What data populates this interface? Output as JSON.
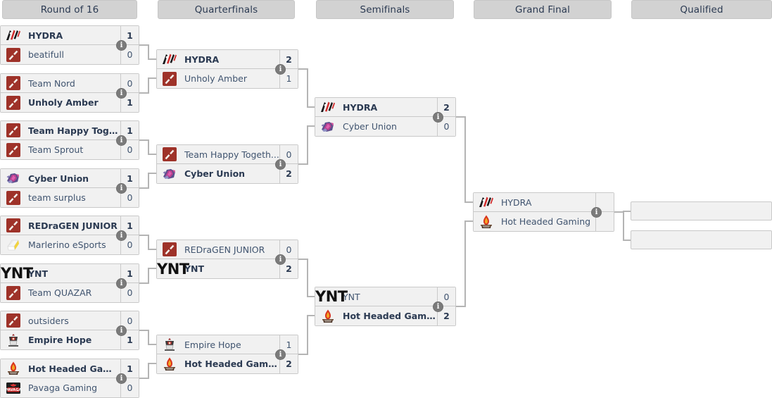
{
  "rounds": [
    {
      "id": "r16",
      "label": "Round of 16"
    },
    {
      "id": "qf",
      "label": "Quarterfinals"
    },
    {
      "id": "sf",
      "label": "Semifinals"
    },
    {
      "id": "gf",
      "label": "Grand Final"
    },
    {
      "id": "q",
      "label": "Qualified"
    }
  ],
  "info_glyph": "i",
  "colors": {
    "header_bg": "#d2d2d2",
    "box_bg": "#f1f1f1",
    "box_border": "#c9c9c9",
    "connector": "#b4b4b4",
    "text": "#40546f",
    "text_bold": "#2b3a52",
    "dota_red": "#a03127"
  },
  "round_of_16": [
    {
      "top": {
        "name": "HYDRA",
        "score": "1",
        "winner": true,
        "logo": "hydra"
      },
      "bottom": {
        "name": "beatifull",
        "score": "0",
        "winner": false,
        "logo": "dota"
      }
    },
    {
      "top": {
        "name": "Team Nord",
        "score": "0",
        "winner": false,
        "logo": "dota"
      },
      "bottom": {
        "name": "Unholy Amber",
        "score": "1",
        "winner": true,
        "logo": "dota"
      }
    },
    {
      "top": {
        "name": "Team Happy Toget...",
        "score": "1",
        "winner": true,
        "logo": "dota"
      },
      "bottom": {
        "name": "Team Sprout",
        "score": "0",
        "winner": false,
        "logo": "dota"
      }
    },
    {
      "top": {
        "name": "Cyber Union",
        "score": "1",
        "winner": true,
        "logo": "cyber"
      },
      "bottom": {
        "name": "team surplus",
        "score": "0",
        "winner": false,
        "logo": "dota"
      }
    },
    {
      "top": {
        "name": "REDraGEN JUNIOR",
        "score": "1",
        "winner": true,
        "logo": "dota"
      },
      "bottom": {
        "name": "Marlerino eSports",
        "score": "0",
        "winner": false,
        "logo": "marlerino"
      }
    },
    {
      "top": {
        "name": "YNT",
        "score": "1",
        "winner": true,
        "logo": "ynt"
      },
      "bottom": {
        "name": "Team QUAZAR",
        "score": "0",
        "winner": false,
        "logo": "dota"
      }
    },
    {
      "top": {
        "name": "outsiders",
        "score": "0",
        "winner": false,
        "logo": "dota"
      },
      "bottom": {
        "name": "Empire Hope",
        "score": "1",
        "winner": true,
        "logo": "empire"
      }
    },
    {
      "top": {
        "name": "Hot Headed Gaming",
        "score": "1",
        "winner": true,
        "logo": "hot"
      },
      "bottom": {
        "name": "Pavaga Gaming",
        "score": "0",
        "winner": false,
        "logo": "pavaga"
      }
    }
  ],
  "quarterfinals": [
    {
      "top": {
        "name": "HYDRA",
        "score": "2",
        "winner": true,
        "logo": "hydra"
      },
      "bottom": {
        "name": "Unholy Amber",
        "score": "1",
        "winner": false,
        "logo": "dota"
      }
    },
    {
      "top": {
        "name": "Team Happy Togeth...",
        "score": "0",
        "winner": false,
        "logo": "dota"
      },
      "bottom": {
        "name": "Cyber Union",
        "score": "2",
        "winner": true,
        "logo": "cyber"
      }
    },
    {
      "top": {
        "name": "REDraGEN JUNIOR",
        "score": "0",
        "winner": false,
        "logo": "dota"
      },
      "bottom": {
        "name": "YNT",
        "score": "2",
        "winner": true,
        "logo": "ynt"
      }
    },
    {
      "top": {
        "name": "Empire Hope",
        "score": "1",
        "winner": false,
        "logo": "empire"
      },
      "bottom": {
        "name": "Hot Headed Gaming",
        "score": "2",
        "winner": true,
        "logo": "hot"
      }
    }
  ],
  "semifinals": [
    {
      "top": {
        "name": "HYDRA",
        "score": "2",
        "winner": true,
        "logo": "hydra"
      },
      "bottom": {
        "name": "Cyber Union",
        "score": "0",
        "winner": false,
        "logo": "cyber"
      }
    },
    {
      "top": {
        "name": "YNT",
        "score": "0",
        "winner": false,
        "logo": "ynt"
      },
      "bottom": {
        "name": "Hot Headed Gaming",
        "score": "2",
        "winner": true,
        "logo": "hot"
      }
    }
  ],
  "grand_final": [
    {
      "top": {
        "name": "HYDRA",
        "score": "",
        "winner": false,
        "logo": "hydra"
      },
      "bottom": {
        "name": "Hot Headed Gaming",
        "score": "",
        "winner": false,
        "logo": "hot"
      }
    }
  ],
  "qualified": [
    {
      "name": "",
      "score": ""
    },
    {
      "name": "",
      "score": ""
    }
  ]
}
